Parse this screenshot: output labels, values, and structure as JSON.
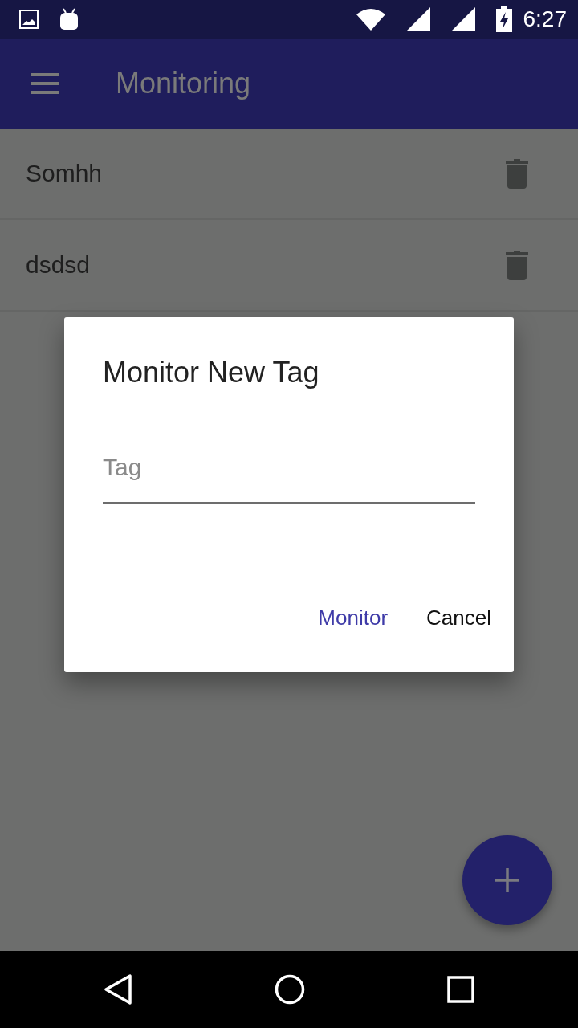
{
  "status_bar": {
    "time": "6:27"
  },
  "app_bar": {
    "title": "Monitoring"
  },
  "items": [
    {
      "name": "Somhh"
    },
    {
      "name": "dsdsd"
    }
  ],
  "dialog": {
    "title": "Monitor New Tag",
    "field": {
      "placeholder": "Tag"
    },
    "buttons": [
      {
        "label": "Monitor",
        "kind": "primary"
      },
      {
        "label": "Cancel",
        "kind": "secondary"
      }
    ]
  }
}
